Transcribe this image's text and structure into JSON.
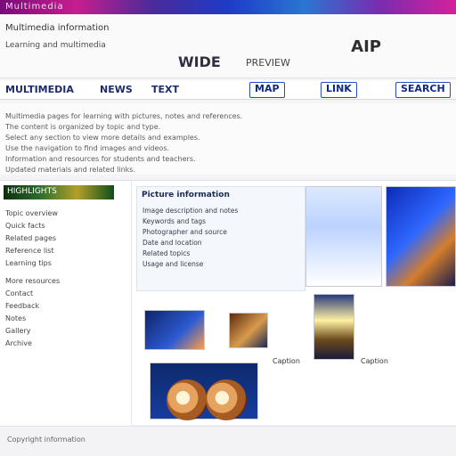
{
  "topstrip": {
    "text": "Multimedia"
  },
  "header": {
    "brand": "Multimedia information",
    "sub": "Learning and multimedia",
    "qty_value": "WIDE",
    "qty_unit": "PREVIEW",
    "right_logo": "AIP"
  },
  "nav": {
    "items": [
      "MULTIMEDIA",
      "NEWS",
      "TEXT",
      "MAP",
      "LINK"
    ],
    "search_label": "SEARCH"
  },
  "info": {
    "lines": [
      "Multimedia pages for learning with pictures, notes and references.",
      "The content is organized by topic and type.",
      "Select any section to view more details and examples.",
      "Use the navigation to find images and videos.",
      "Information and resources for students and teachers.",
      "Updated materials and related links."
    ]
  },
  "left": {
    "header": "HIGHLIGHTS",
    "lines": [
      "Topic overview",
      "Quick facts",
      "Related pages",
      "Reference list",
      "Learning tips",
      "More resources",
      "Contact",
      "Feedback",
      "Notes",
      "Gallery",
      "Archive"
    ]
  },
  "center": {
    "title": "Picture information",
    "lines": [
      "Image description and notes",
      "Keywords and tags",
      "Photographer and source",
      "Date and location",
      "Related topics",
      "Usage and license"
    ]
  },
  "captions": {
    "bottom_left": "Caption",
    "bottom_right": "Caption"
  },
  "footer": {
    "text": "Copyright information"
  }
}
